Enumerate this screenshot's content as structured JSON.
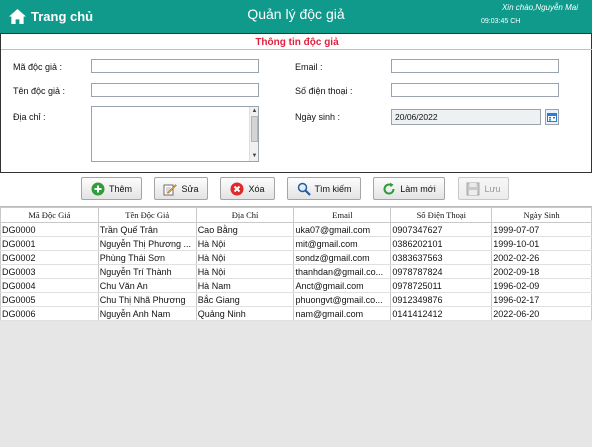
{
  "header": {
    "home_label": "Trang chủ",
    "title": "Quản lý độc giả",
    "greeting": "Xin chào,Nguyễn Mai",
    "time": "09:03:45 CH",
    "bg_color": "#0f9a8c"
  },
  "form": {
    "section_title": "Thông tin độc giả",
    "title_color": "#e0213f",
    "ma_doc_gia": {
      "label": "Mã độc giả :",
      "value": ""
    },
    "ten_doc_gia": {
      "label": "Tên độc giả :",
      "value": ""
    },
    "dia_chi": {
      "label": "Địa chỉ :",
      "value": ""
    },
    "email": {
      "label": "Email :",
      "value": ""
    },
    "so_dien_thoai": {
      "label": "Số điện thoại :",
      "value": ""
    },
    "ngay_sinh": {
      "label": "Ngày sinh :",
      "value": "20/06/2022"
    }
  },
  "toolbar": {
    "add": "Thêm",
    "edit": "Sửa",
    "delete": "Xóa",
    "search": "Tìm kiếm",
    "refresh": "Làm mới",
    "save": "Lưu"
  },
  "table": {
    "columns": [
      "Mã Độc Giả",
      "Tên Độc Giả",
      "Địa Chỉ",
      "Email",
      "Số Điện Thoại",
      "Ngày Sinh"
    ],
    "rows": [
      [
        "DG0000",
        "Trần Quế Trân",
        "Cao Bằng",
        "uka07@gmail.com",
        "0907347627",
        "1999-07-07"
      ],
      [
        "DG0001",
        "Nguyễn Thị Phương ...",
        "Hà Nội",
        "mit@gmail.com",
        "0386202101",
        "1999-10-01"
      ],
      [
        "DG0002",
        "Phùng Thái Sơn",
        "Hà Nội",
        "sondz@gmail.com",
        "0383637563",
        "2002-02-26"
      ],
      [
        "DG0003",
        "Nguyễn Trí Thành",
        "Hà Nội",
        "thanhdan@gmail.co...",
        "0978787824",
        "2002-09-18"
      ],
      [
        "DG0004",
        "Chu Văn An",
        "Hà Nam",
        "Anct@gmail.com",
        "0978725011",
        "1996-02-09"
      ],
      [
        "DG0005",
        "Chu Thị Nhã Phương",
        "Bắc Giang",
        "phuongvt@gmail.co...",
        "0912349876",
        "1996-02-17"
      ],
      [
        "DG0006",
        "Nguyễn Anh Nam",
        "Quảng Ninh",
        "nam@gmail.com",
        "0141412412",
        "2022-06-20"
      ]
    ]
  }
}
